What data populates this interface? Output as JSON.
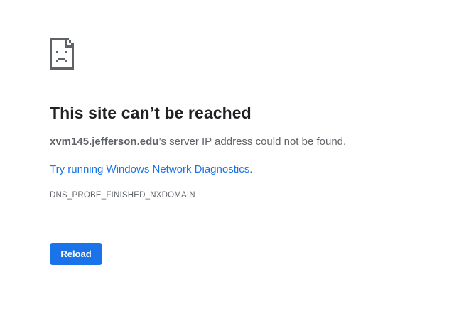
{
  "error_page": {
    "icon": "sad-document-icon",
    "title": "This site can’t be reached",
    "host": "xvm145.jefferson.edu",
    "message_suffix": "’s server IP address could not be found.",
    "suggestion_link": "Try running Windows Network Diagnostics",
    "suggestion_suffix": ".",
    "error_code": "DNS_PROBE_FINISHED_NXDOMAIN",
    "reload_label": "Reload"
  },
  "colors": {
    "accent": "#1a73e8",
    "title_text": "#202124",
    "body_text": "#5f6368"
  }
}
